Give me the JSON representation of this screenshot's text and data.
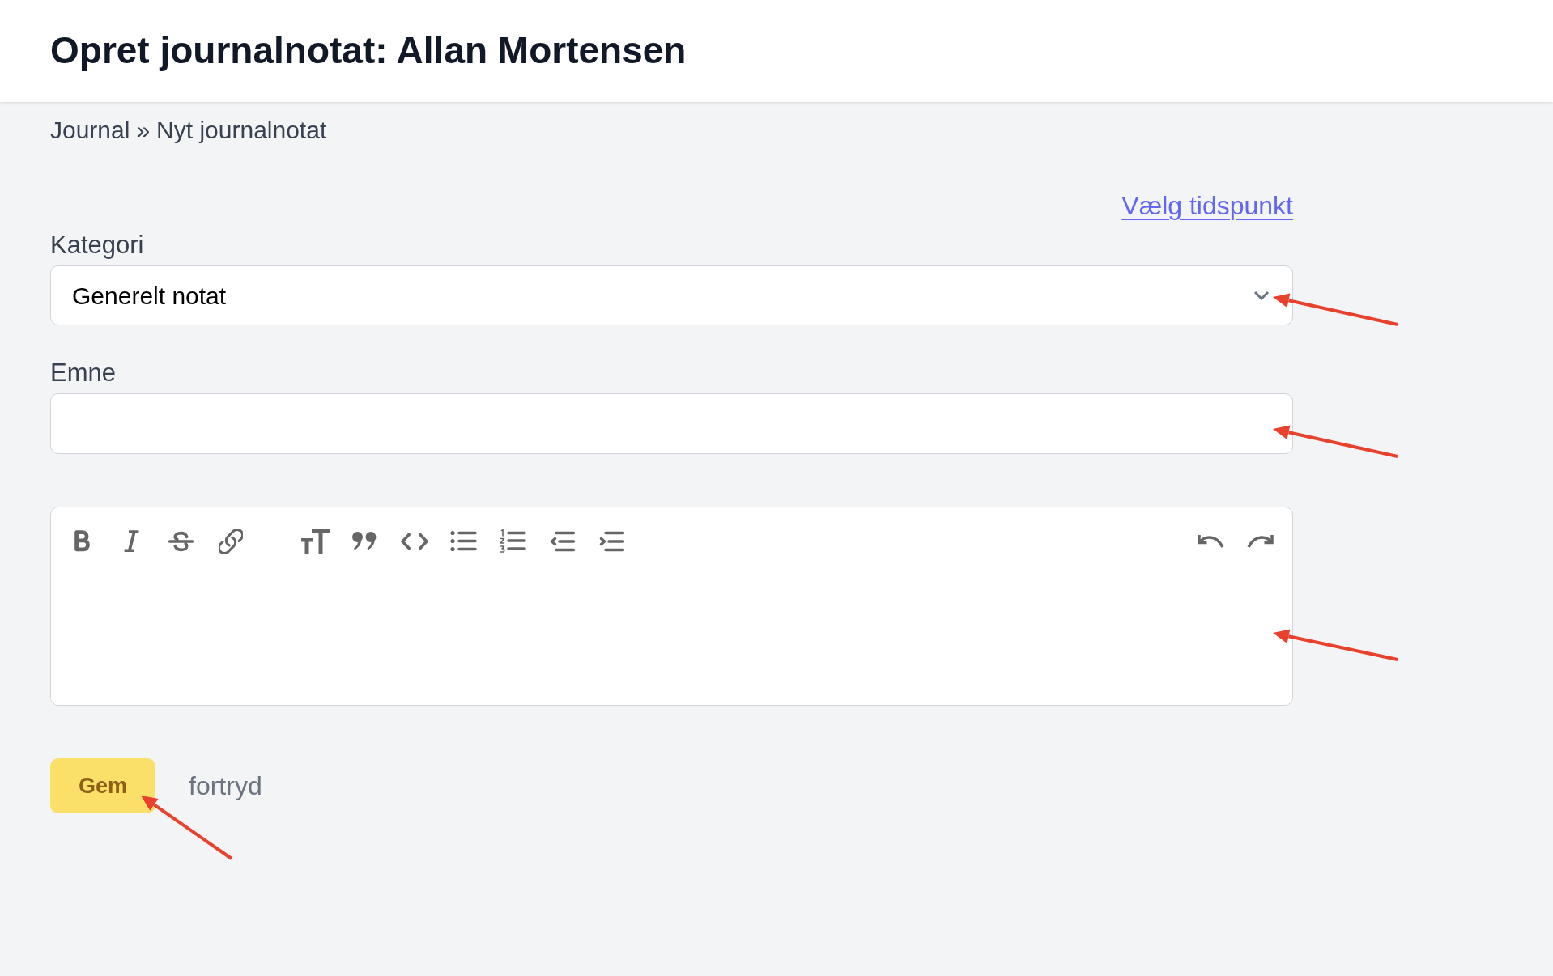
{
  "header": {
    "title": "Opret journalnotat: Allan Mortensen"
  },
  "breadcrumb": {
    "items": [
      "Journal",
      "Nyt journalnotat"
    ],
    "separator": "»"
  },
  "time_link": {
    "label": "Vælg tidspunkt"
  },
  "fields": [
    {
      "kind": "select",
      "label": "Kategori",
      "value": "Generelt notat"
    },
    {
      "kind": "text",
      "label": "Emne"
    }
  ],
  "actions": {
    "save": "Gem",
    "cancel": "fortryd"
  }
}
